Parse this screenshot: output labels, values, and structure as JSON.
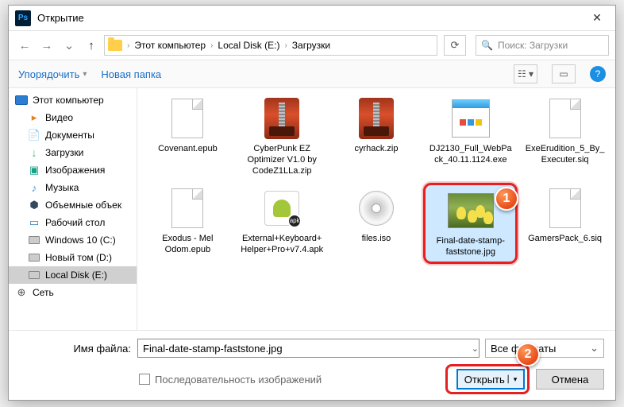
{
  "title": "Открытие",
  "breadcrumb": [
    "Этот компьютер",
    "Local Disk (E:)",
    "Загрузки"
  ],
  "search_placeholder": "Поиск: Загрузки",
  "toolbar": {
    "organize": "Упорядочить",
    "newfolder": "Новая папка"
  },
  "sidebar": [
    {
      "label": "Этот компьютер",
      "icon": "mon",
      "ind": false
    },
    {
      "label": "Видео",
      "icon": "vid",
      "ind": true
    },
    {
      "label": "Документы",
      "icon": "doc",
      "ind": true
    },
    {
      "label": "Загрузки",
      "icon": "dl",
      "ind": true
    },
    {
      "label": "Изображения",
      "icon": "img",
      "ind": true
    },
    {
      "label": "Музыка",
      "icon": "mus",
      "ind": true
    },
    {
      "label": "Объемные объек",
      "icon": "vol",
      "ind": true
    },
    {
      "label": "Рабочий стол",
      "icon": "desk",
      "ind": true
    },
    {
      "label": "Windows 10 (C:)",
      "icon": "disk",
      "ind": true
    },
    {
      "label": "Новый том (D:)",
      "icon": "disk",
      "ind": true
    },
    {
      "label": "Local Disk (E:)",
      "icon": "disk",
      "ind": true,
      "sel": true
    },
    {
      "label": "Сеть",
      "icon": "net",
      "ind": false
    }
  ],
  "files_row1": [
    {
      "name": "Covenant.epub",
      "type": "page"
    },
    {
      "name": "CyberPunk EZ Optimizer V1.0 by CodeZ1LLa.zip",
      "type": "zip"
    },
    {
      "name": "cyrhack.zip",
      "type": "zip"
    },
    {
      "name": "DJ2130_Full_WebPack_40.11.1124.exe",
      "type": "exe"
    },
    {
      "name": "ExeErudition_5_By_Executer.siq",
      "type": "page"
    }
  ],
  "files_row2": [
    {
      "name": "Exodus - Mel Odom.epub",
      "type": "page"
    },
    {
      "name": "External+Keyboard+Helper+Pro+v7.4.apk",
      "type": "apk"
    },
    {
      "name": "files.iso",
      "type": "iso"
    },
    {
      "name": "Final-date-stamp-faststone.jpg",
      "type": "thumb",
      "sel": true
    },
    {
      "name": "GamersPack_6.siq",
      "type": "page"
    }
  ],
  "filename_label": "Имя файла:",
  "filename_value": "Final-date-stamp-faststone.jpg",
  "format_label": "Все форматы",
  "sequence_label": "Последовательность изображений",
  "open_label": "Открыть",
  "cancel_label": "Отмена",
  "callout1": "1",
  "callout2": "2"
}
